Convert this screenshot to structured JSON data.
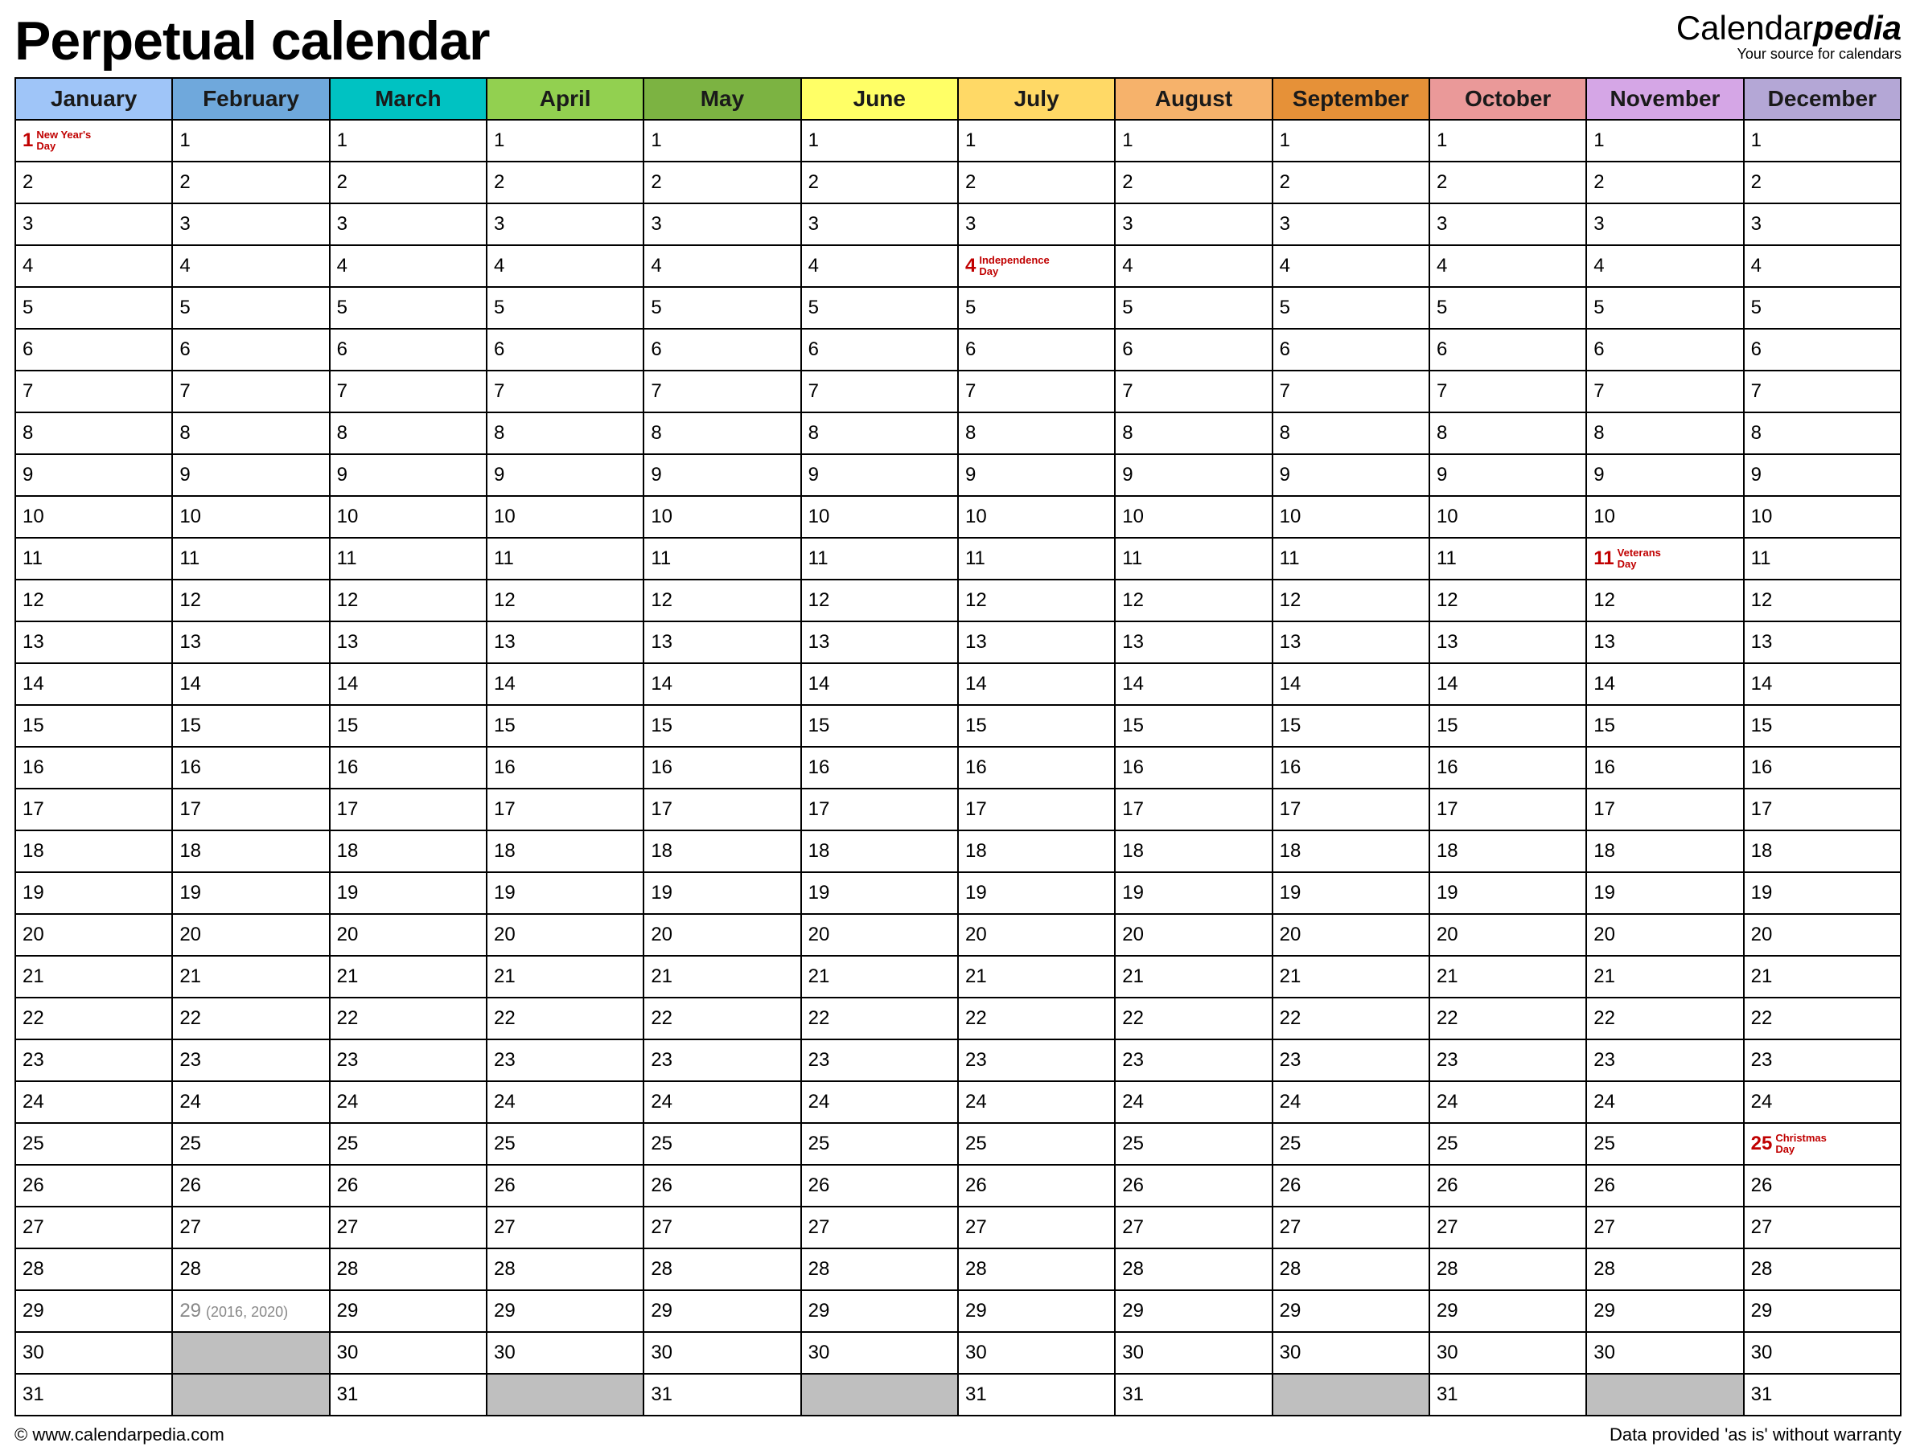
{
  "header": {
    "title": "Perpetual calendar",
    "brand_prefix": "Calendar",
    "brand_suffix": "pedia",
    "brand_tagline": "Your source for calendars"
  },
  "months": [
    {
      "name": "January",
      "color": "#9fc5f8",
      "days": 31
    },
    {
      "name": "February",
      "color": "#6fa8dc",
      "days": 29
    },
    {
      "name": "March",
      "color": "#00c2c2",
      "days": 31
    },
    {
      "name": "April",
      "color": "#92d050",
      "days": 30
    },
    {
      "name": "May",
      "color": "#7cb342",
      "days": 31
    },
    {
      "name": "June",
      "color": "#ffff66",
      "days": 30
    },
    {
      "name": "July",
      "color": "#ffd966",
      "days": 31
    },
    {
      "name": "August",
      "color": "#f6b26b",
      "days": 31
    },
    {
      "name": "September",
      "color": "#e69138",
      "days": 30
    },
    {
      "name": "October",
      "color": "#ea9999",
      "days": 31
    },
    {
      "name": "November",
      "color": "#d5a6e6",
      "days": 30
    },
    {
      "name": "December",
      "color": "#b4a7d6",
      "days": 31
    }
  ],
  "max_day": 31,
  "holidays": [
    {
      "month": 0,
      "day": 1,
      "name": "New Year's Day"
    },
    {
      "month": 6,
      "day": 4,
      "name": "Independence Day"
    },
    {
      "month": 10,
      "day": 11,
      "name": "Veterans Day"
    },
    {
      "month": 11,
      "day": 25,
      "name": "Christmas Day"
    }
  ],
  "leap_note": {
    "month": 1,
    "day": 29,
    "text": "(2016, 2020)"
  },
  "footer": {
    "copyright": "© www.calendarpedia.com",
    "disclaimer": "Data provided 'as is' without warranty"
  }
}
